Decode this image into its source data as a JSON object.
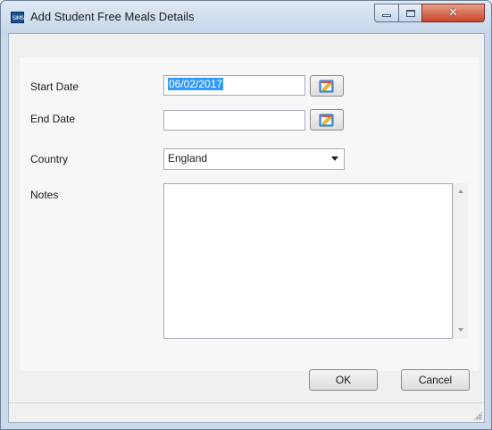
{
  "window": {
    "title": "Add Student Free Meals Details",
    "icon_text": "SIMS",
    "close_glyph": "✕"
  },
  "form": {
    "start_date": {
      "label": "Start Date",
      "value": "06/02/2017"
    },
    "end_date": {
      "label": "End Date",
      "value": ""
    },
    "country": {
      "label": "Country",
      "value": "England"
    },
    "notes": {
      "label": "Notes",
      "value": ""
    }
  },
  "buttons": {
    "ok": "OK",
    "cancel": "Cancel"
  },
  "colors": {
    "selection": "#3399ff",
    "close_button": "#c6452b",
    "title_bar": "#c6d6ea"
  },
  "icons": {
    "start_date_picker": "calendar-icon",
    "end_date_picker": "calendar-icon",
    "country_dropdown": "chevron-down-icon"
  }
}
